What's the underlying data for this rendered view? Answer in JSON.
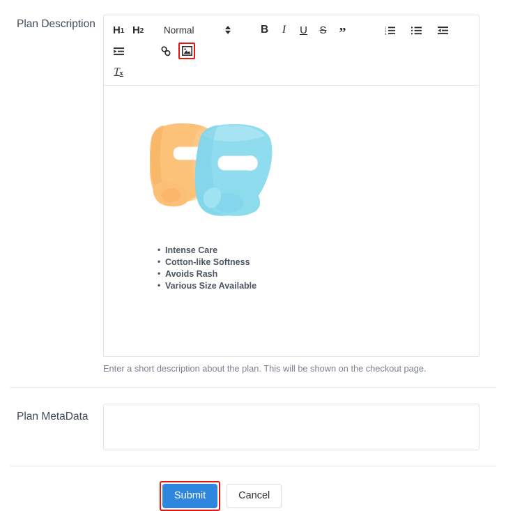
{
  "form": {
    "description_field": {
      "label": "Plan Description",
      "help_text": "Enter a short description about the plan. This will be shown on the checkout page."
    },
    "metadata_field": {
      "label": "Plan MetaData",
      "value": "",
      "placeholder": ""
    }
  },
  "editor": {
    "toolbar": {
      "heading1": "H1",
      "heading1_text": "H",
      "heading1_sub": "1",
      "heading2_text": "H",
      "heading2_sub": "2",
      "format_picker_value": "Normal",
      "bold": "B",
      "italic": "I",
      "underline": "U",
      "strikethrough": "S",
      "blockquote": "”",
      "clear_format_text": "T",
      "clear_format_sub": "x",
      "icons": {
        "ordered_list": "ordered-list-icon",
        "bullet_list": "bullet-list-icon",
        "outdent": "outdent-icon",
        "indent": "indent-icon",
        "link": "link-icon",
        "image": "image-icon"
      },
      "highlighted_button": "image-icon"
    },
    "content": {
      "image_alt": "Two cloth diapers, one peach and one light blue",
      "bullets": [
        "Intense Care",
        "Cotton-like Softness",
        "Avoids Rash",
        "Various Size Available"
      ]
    }
  },
  "actions": {
    "submit_label": "Submit",
    "cancel_label": "Cancel",
    "highlighted_button": "submit-button"
  },
  "colors": {
    "primary_blue": "#2e86de",
    "highlight_red": "#e8140d",
    "label_text": "#3f4b5b",
    "help_text": "#7a8290",
    "border": "#dfe3e8",
    "diaper_peach": "#fbc98a",
    "diaper_blue": "#8fdcee"
  }
}
